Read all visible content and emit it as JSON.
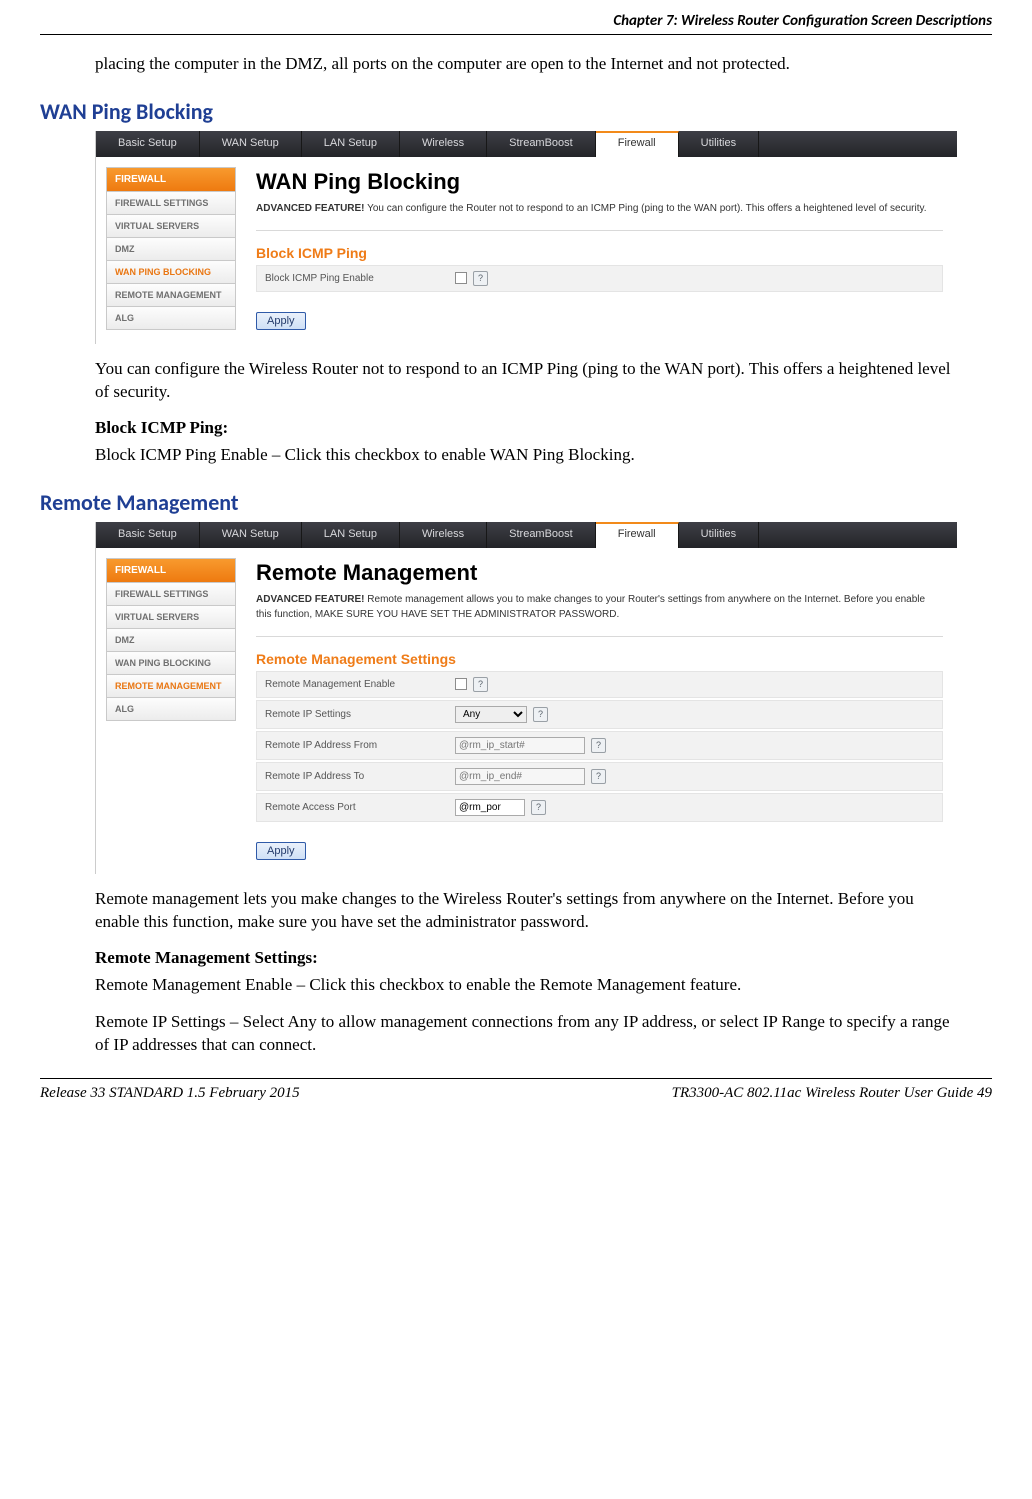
{
  "header": {
    "chapter": "Chapter 7: Wireless Router Configuration Screen Descriptions"
  },
  "intro_continuation": "placing the computer in the DMZ, all ports on the computer are open to the Internet and not protected.",
  "section1": {
    "heading": "WAN Ping Blocking",
    "after_text": "You can configure the Wireless Router not to respond to an ICMP Ping (ping to the WAN port). This offers a heightened level of security.",
    "strong": "Block ICMP Ping:",
    "detail": "Block ICMP Ping Enable – Click this checkbox to enable WAN Ping Blocking."
  },
  "section2": {
    "heading": "Remote Management",
    "after_text": "Remote management lets you make changes to the Wireless Router's settings from anywhere on the Internet. Before you enable this function, make sure you have set the administrator password.",
    "strong": "Remote Management Settings:",
    "detail1": "Remote Management Enable – Click this checkbox to enable the Remote Management feature.",
    "detail2": "Remote IP Settings – Select Any to allow management connections from any IP address, or select IP Range to specify a range of IP addresses that can connect."
  },
  "tabs": [
    "Basic Setup",
    "WAN Setup",
    "LAN Setup",
    "Wireless",
    "StreamBoost",
    "Firewall",
    "Utilities"
  ],
  "active_tab": "Firewall",
  "sidenav": {
    "header": "FIREWALL",
    "items": [
      "FIREWALL SETTINGS",
      "VIRTUAL SERVERS",
      "DMZ",
      "WAN PING BLOCKING",
      "REMOTE MANAGEMENT",
      "ALG"
    ]
  },
  "shot1": {
    "title": "WAN Ping Blocking",
    "desc_prefix": "ADVANCED FEATURE!",
    "desc_rest": " You can configure the Router not to respond to an ICMP Ping (ping to the WAN port). This offers a heightened level of security.",
    "subhead": "Block ICMP Ping",
    "field1_label": "Block ICMP Ping Enable",
    "apply": "Apply",
    "active_side": "WAN PING BLOCKING"
  },
  "shot2": {
    "title": "Remote Management",
    "desc_prefix": "ADVANCED FEATURE!",
    "desc_rest": " Remote management allows you to make changes to your Router's settings from anywhere on the Internet. Before you enable this function, MAKE SURE YOU HAVE SET THE ADMINISTRATOR PASSWORD.",
    "subhead": "Remote Management Settings",
    "fields": {
      "enable": "Remote Management Enable",
      "ipset": "Remote IP Settings",
      "ipset_value": "Any",
      "from": "Remote IP Address From",
      "from_ph": "@rm_ip_start#",
      "to": "Remote IP Address To",
      "to_ph": "@rm_ip_end#",
      "port": "Remote Access Port",
      "port_val": "@rm_por"
    },
    "apply": "Apply",
    "active_side": "REMOTE MANAGEMENT"
  },
  "footer": {
    "left": "Release 33 STANDARD 1.5    February 2015",
    "right": "TR3300-AC 802.11ac Wireless Router User Guide    49"
  }
}
